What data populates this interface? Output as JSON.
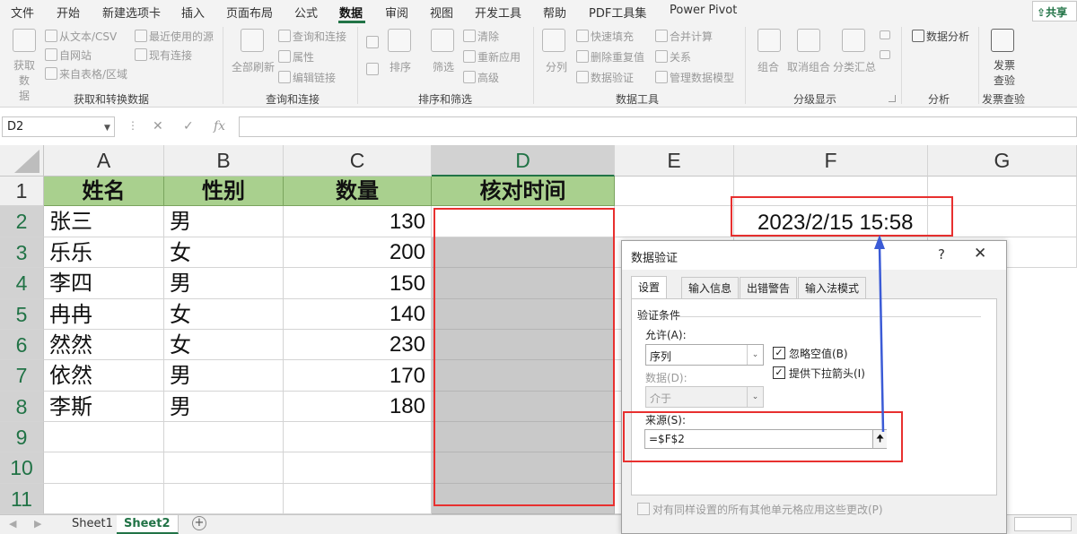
{
  "menu": {
    "items": [
      "文件",
      "开始",
      "新建选项卡",
      "插入",
      "页面布局",
      "公式",
      "数据",
      "审阅",
      "视图",
      "开发工具",
      "帮助",
      "PDF工具集",
      "Power Pivot"
    ],
    "active": "数据",
    "share_label": "共享"
  },
  "ribbon": {
    "get_data_label": "获取数\n据",
    "from_text_csv": "从文本/CSV",
    "from_web": "自网站",
    "from_table": "来自表格/区域",
    "recent_sources": "最近使用的源",
    "existing_connections": "现有连接",
    "group_get_transform": "获取和转换数据",
    "refresh_all": "全部刷新",
    "queries_connections": "查询和连接",
    "properties": "属性",
    "edit_links": "编辑链接",
    "group_queries": "查询和连接",
    "sort": "排序",
    "filter": "筛选",
    "clear": "清除",
    "reapply": "重新应用",
    "advanced": "高级",
    "group_sort_filter": "排序和筛选",
    "text_to_columns": "分列",
    "flash_fill": "快速填充",
    "remove_duplicates": "删除重复值",
    "data_validation": "数据验证",
    "consolidate": "合并计算",
    "relationships": "关系",
    "manage_model": "管理数据模型",
    "group_data_tools": "数据工具",
    "group_btn": "组合",
    "ungroup_btn": "取消组合",
    "subtotal": "分类汇总",
    "group_outline": "分级显示",
    "data_analysis": "数据分析",
    "group_analysis": "分析",
    "invoice_check": "发票\n查验",
    "group_invoice": "发票查验"
  },
  "formula_bar": {
    "name_box": "D2",
    "fx": "fx",
    "formula": ""
  },
  "grid": {
    "columns": [
      "A",
      "B",
      "C",
      "D",
      "E",
      "F",
      "G"
    ],
    "selected_column": "D",
    "rows": [
      "1",
      "2",
      "3",
      "4",
      "5",
      "6",
      "7",
      "8",
      "9",
      "10",
      "11"
    ],
    "header_row": [
      "姓名",
      "性别",
      "数量",
      "核对时间"
    ],
    "data": [
      {
        "name": "张三",
        "gender": "男",
        "qty": "130"
      },
      {
        "name": "乐乐",
        "gender": "女",
        "qty": "200"
      },
      {
        "name": "李四",
        "gender": "男",
        "qty": "150"
      },
      {
        "name": "冉冉",
        "gender": "女",
        "qty": "140"
      },
      {
        "name": "然然",
        "gender": "女",
        "qty": "230"
      },
      {
        "name": "依然",
        "gender": "男",
        "qty": "170"
      },
      {
        "name": "李斯",
        "gender": "男",
        "qty": "180"
      }
    ],
    "f2_value": "2023/2/15 15:58"
  },
  "sheets": {
    "tabs": [
      "Sheet1",
      "Sheet2"
    ],
    "active": "Sheet2"
  },
  "dialog": {
    "title": "数据验证",
    "help": "?",
    "close": "✕",
    "tabs": [
      "设置",
      "输入信息",
      "出错警告",
      "输入法模式"
    ],
    "active_tab": "设置",
    "criteria_label": "验证条件",
    "allow_label": "允许(A):",
    "allow_value": "序列",
    "data_label": "数据(D):",
    "data_value": "介于",
    "ignore_blank_label": "忽略空值(B)",
    "ignore_blank_checked": true,
    "dropdown_label": "提供下拉箭头(I)",
    "dropdown_checked": true,
    "source_label": "来源(S):",
    "source_value": "=$F$2",
    "apply_all_label": "对有同样设置的所有其他单元格应用这些更改(P)",
    "apply_all_checked": false
  },
  "colors": {
    "accent": "#217346",
    "header_fill": "#a9d08e",
    "selection_grey": "#c9c9c9",
    "highlight_red": "#e8302f",
    "arrow_blue": "#3b5bd6"
  }
}
